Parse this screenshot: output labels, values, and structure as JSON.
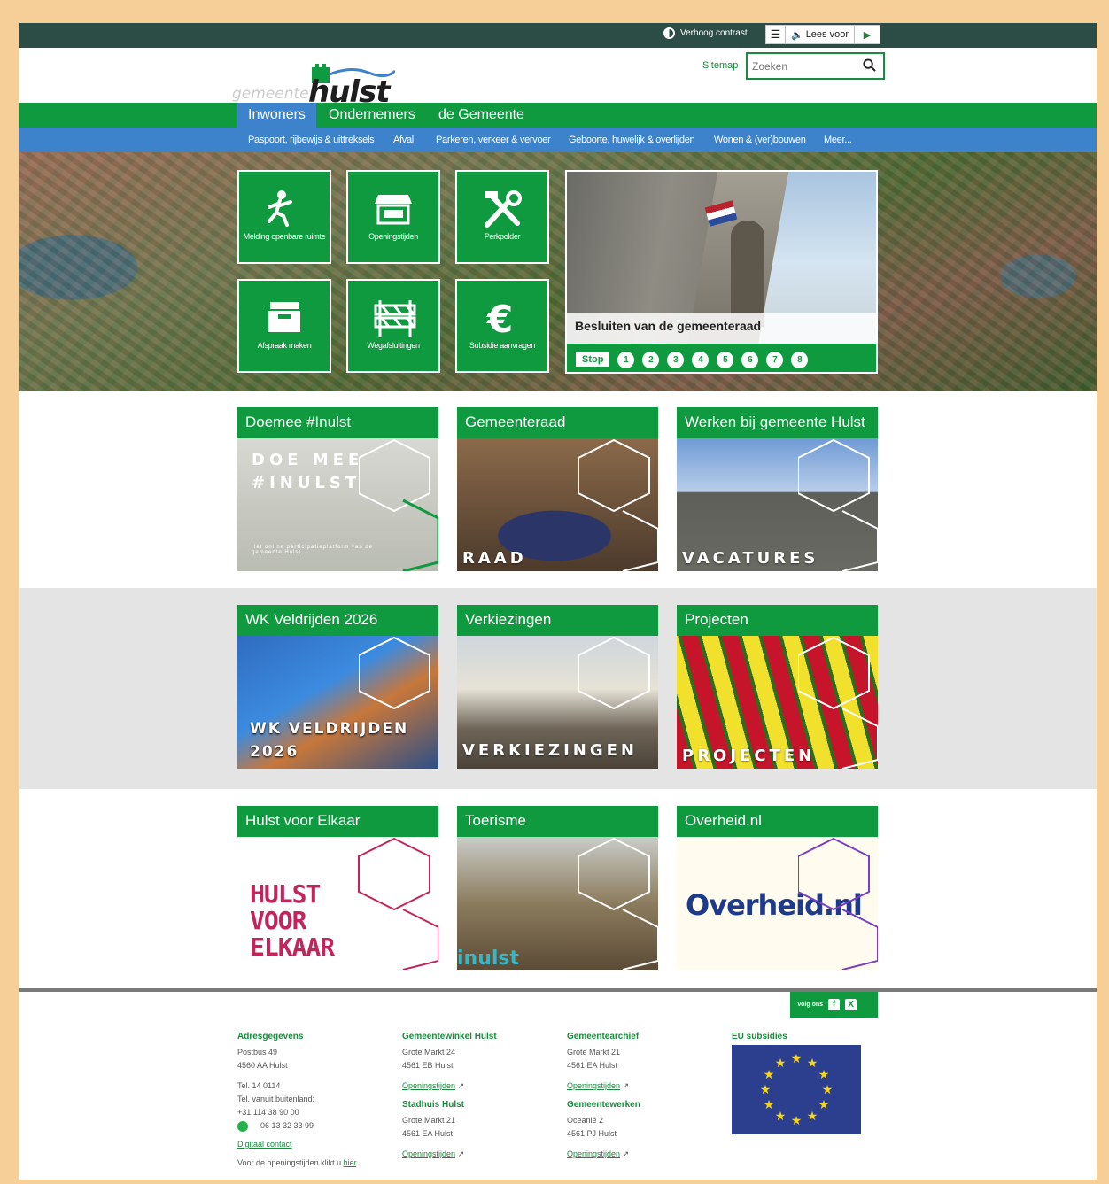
{
  "topbar": {
    "contrast_label": "Verhoog contrast",
    "read_label": "Lees voor"
  },
  "header": {
    "logo_prefix": "gemeente",
    "logo_name": "hulst",
    "sitemap": "Sitemap",
    "search_placeholder": "Zoeken"
  },
  "main_nav": [
    {
      "label": "Inwoners",
      "active": true
    },
    {
      "label": "Ondernemers"
    },
    {
      "label": "de Gemeente"
    }
  ],
  "sub_nav": [
    "Paspoort, rijbewijs & uittreksels",
    "Afval",
    "Parkeren, verkeer & vervoer",
    "Geboorte, huwelijk & overlijden",
    "Wonen & (ver)bouwen",
    "Meer..."
  ],
  "quick_tiles": [
    {
      "label": "Melding openbare ruimte",
      "icon": "person-slip-icon"
    },
    {
      "label": "Openingstijden",
      "icon": "shop-open-icon"
    },
    {
      "label": "Perkpolder",
      "icon": "tools-icon"
    },
    {
      "label": "Afspraak maken",
      "icon": "inbox-icon"
    },
    {
      "label": "Wegafsluitingen",
      "icon": "road-barrier-icon"
    },
    {
      "label": "Subsidie aanvragen",
      "icon": "euro-icon"
    }
  ],
  "slider": {
    "caption": "Besluiten van de gemeenteraad",
    "stop_label": "Stop",
    "pages": [
      "1",
      "2",
      "3",
      "4",
      "5",
      "6",
      "7",
      "8"
    ]
  },
  "tiles": [
    {
      "title": "Doemee #Inulst",
      "overlay": "DOE MEE #INULST",
      "sub": "Het online participatieplatform van de gemeente Hulst"
    },
    {
      "title": "Gemeenteraad",
      "overlay": "RAAD"
    },
    {
      "title": "Werken bij gemeente Hulst",
      "overlay": "VACATURES"
    },
    {
      "title": "WK Veldrijden 2026",
      "overlay": "WK VELDRIJDEN 2026"
    },
    {
      "title": "Verkiezingen",
      "overlay": "VERKIEZINGEN"
    },
    {
      "title": "Projecten",
      "overlay": "PROJECTEN"
    },
    {
      "title": "Hulst voor Elkaar",
      "overlay": "HULST VOOR ELKAAR"
    },
    {
      "title": "Toerisme",
      "overlay": "inulst"
    },
    {
      "title": "Overheid.nl",
      "overlay": "Overheid.nl"
    }
  ],
  "footer": {
    "follow": "Volg ons",
    "adres": {
      "title": "Adresgegevens",
      "l1": "Postbus 49",
      "l2": "4560 AA Hulst",
      "l3": "Tel. 14 0114",
      "l4": "Tel. vanuit buitenland:",
      "l5": "+31 114 38 90 00",
      "whatsapp": "06 13 32 33 99",
      "digital": "Digitaal contact",
      "note_pre": "Voor de openingstijden klikt u",
      "note_link": "hier",
      "note_end": "."
    },
    "winkel": {
      "title": "Gemeentewinkel Hulst",
      "l1": "Grote Markt 24",
      "l2": "4561 EB Hulst",
      "link": "Openingstijden"
    },
    "stadhuis": {
      "title": "Stadhuis Hulst",
      "l1": "Grote Markt 21",
      "l2": "4561 EA Hulst",
      "link": "Openingstijden"
    },
    "archief": {
      "title": "Gemeentearchief",
      "l1": "Grote Markt 21",
      "l2": "4561 EA Hulst",
      "link": "Openingstijden"
    },
    "werken": {
      "title": "Gemeentewerken",
      "l1": "Oceanië 2",
      "l2": "4561 PJ  Hulst",
      "link": "Openingstijden"
    },
    "eu": {
      "title": "EU subsidies"
    }
  },
  "colors": {
    "green": "#0f9a3f",
    "blue": "#3d83cc",
    "topbar": "#2b4d45",
    "page_border": "#f6cf98"
  }
}
